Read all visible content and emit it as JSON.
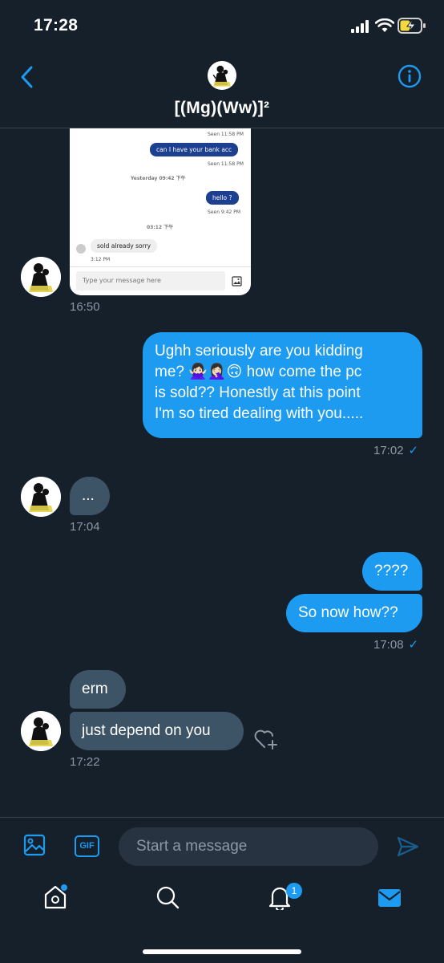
{
  "status": {
    "time": "17:28"
  },
  "header": {
    "title": "[(Mg)(Ww)]²"
  },
  "shared_screenshot": {
    "top_seen": "Seen  11:58 PM",
    "msg1": "can I have your bank acc",
    "msg1_seen": "Seen  11:58 PM",
    "date1": "Yesterday 09:42 下午",
    "msg2": "hello ?",
    "msg2_seen": "Seen  9:42 PM",
    "date2": "03:12 下午",
    "reply": "sold already sorry",
    "reply_time": "3:12 PM",
    "input_placeholder": "Type your message here"
  },
  "messages": [
    {
      "id": "img",
      "direction": "in",
      "time": "16:50"
    },
    {
      "id": "m1",
      "direction": "out",
      "lines": [
        "Ughh seriously are you kidding",
        "me? 🙅🏻‍♀️🤦🏻‍♀️🙃  how come the pc",
        "is sold?? Honestly at this point",
        "I'm so tired dealing with you....."
      ],
      "time": "17:02",
      "check": "✓"
    },
    {
      "id": "m2",
      "direction": "in",
      "text": "...",
      "time": "17:04"
    },
    {
      "id": "m3",
      "direction": "out",
      "text": "????"
    },
    {
      "id": "m4",
      "direction": "out",
      "text": "So now how??",
      "time": "17:08",
      "check": "✓"
    },
    {
      "id": "m5",
      "direction": "in",
      "text": "erm"
    },
    {
      "id": "m6",
      "direction": "in",
      "text": "just depend on you",
      "time": "17:22"
    }
  ],
  "composer": {
    "gif_label": "GIF",
    "placeholder": "Start a message"
  },
  "tabbar": {
    "notification_count": "1"
  },
  "colors": {
    "background": "#15202b",
    "accent": "#1d9bf0",
    "incoming_bubble": "#3d5466",
    "muted_text": "#8b98a5"
  },
  "icons": [
    "back-icon",
    "info-icon",
    "image-icon",
    "gif-icon",
    "send-icon",
    "home-icon",
    "search-icon",
    "bell-icon",
    "mail-icon",
    "add-reaction-icon"
  ]
}
